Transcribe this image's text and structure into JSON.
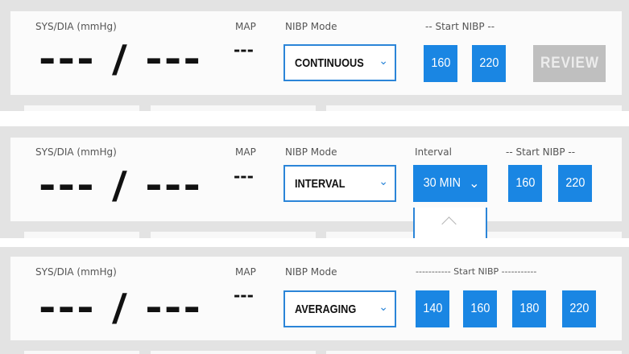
{
  "panels": [
    {
      "sys_label": "SYS/DIA (mmHg)",
      "bp_value": "--- / ---",
      "map_label": "MAP",
      "map_value": "---",
      "mode_label": "NIBP Mode",
      "mode_value": "CONTINUOUS",
      "start_label": "-- Start NIBP --",
      "start_buttons": [
        "160",
        "220"
      ],
      "review_label": "REVIEW"
    },
    {
      "sys_label": "SYS/DIA (mmHg)",
      "bp_value": "--- / ---",
      "map_label": "MAP",
      "map_value": "---",
      "mode_label": "NIBP Mode",
      "mode_value": "INTERVAL",
      "interval_label": "Interval",
      "interval_value": "30 MIN",
      "start_label": "-- Start NIBP --",
      "start_buttons": [
        "160",
        "220"
      ]
    },
    {
      "sys_label": "SYS/DIA (mmHg)",
      "bp_value": "--- / ---",
      "map_label": "MAP",
      "map_value": "---",
      "mode_label": "NIBP Mode",
      "mode_value": "AVERAGING",
      "start_label": "----------- Start NIBP -----------",
      "start_buttons": [
        "140",
        "160",
        "180",
        "220"
      ]
    }
  ],
  "icons": {
    "select_chevron": "chevron-down-icon",
    "interval_chevron": "chevron-down-icon",
    "dropdown_scroll": "chevron-up-icon"
  },
  "colors": {
    "accent": "#1a86e3",
    "panel_bg": "#e3e3e3",
    "card_bg": "#fbfbfb",
    "disabled": "#bfbfbf"
  }
}
